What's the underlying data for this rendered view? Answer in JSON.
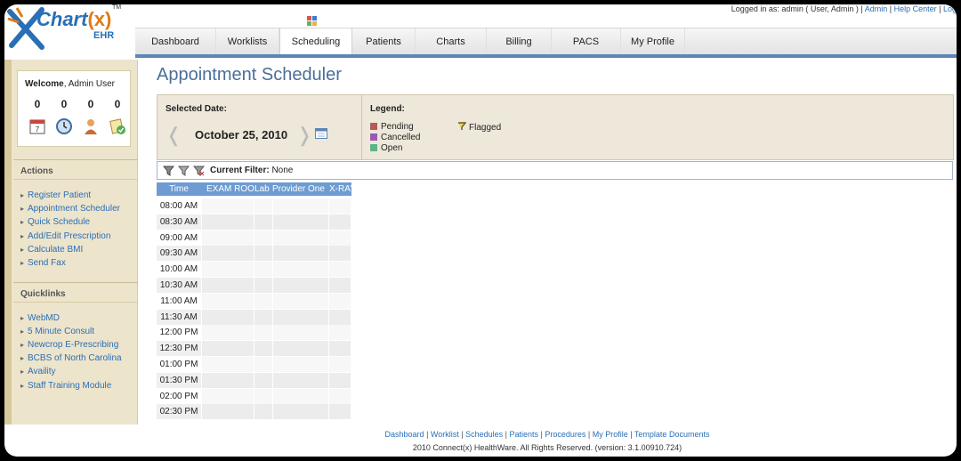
{
  "header": {
    "logo_text": "Chart",
    "logo_x": "(x)",
    "logo_sub": "EHR",
    "logo_tm": "TM",
    "logged_in": "Logged in as: admin ( User, Admin )  |",
    "help_link": "Admin",
    "help_center": "Help Center",
    "logout": "Log"
  },
  "tabs": [
    {
      "label": "Dashboard"
    },
    {
      "label": "Worklists"
    },
    {
      "label": "Scheduling"
    },
    {
      "label": "Patients"
    },
    {
      "label": "Charts"
    },
    {
      "label": "Billing"
    },
    {
      "label": "PACS"
    },
    {
      "label": "My Profile"
    }
  ],
  "sidebar": {
    "welcome_bold": "Welcome",
    "welcome_name": ", Admin User",
    "counts": [
      "0",
      "0",
      "0",
      "0"
    ],
    "actions_title": "Actions",
    "actions": [
      "Register Patient",
      "Appointment Scheduler",
      "Quick Schedule",
      "Add/Edit Prescription",
      "Calculate BMI",
      "Send Fax"
    ],
    "quicklinks_title": "Quicklinks",
    "quicklinks": [
      "WebMD",
      "5 Minute Consult",
      "Newcrop E-Prescribing",
      "BCBS of North Carolina",
      "Availity",
      "Staff Training Module"
    ]
  },
  "main": {
    "page_title": "Appointment Scheduler",
    "selected_date_label": "Selected Date:",
    "selected_date": "October 25, 2010",
    "legend_label": "Legend:",
    "legend": [
      {
        "label": "Pending",
        "color": "#b35a5a"
      },
      {
        "label": "Cancelled",
        "color": "#9b5bb5"
      },
      {
        "label": "Open",
        "color": "#5bb585"
      }
    ],
    "flagged_label": "Flagged",
    "filter_label": "Current Filter:",
    "filter_value": "None",
    "grid_headers": [
      "Time",
      "EXAM ROOM",
      "Lab",
      "Provider One",
      "X-RAY"
    ],
    "times": [
      "08:00 AM",
      "08:30 AM",
      "09:00 AM",
      "09:30 AM",
      "10:00 AM",
      "10:30 AM",
      "11:00 AM",
      "11:30 AM",
      "12:00 PM",
      "12:30 PM",
      "01:00 PM",
      "01:30 PM",
      "02:00 PM",
      "02:30 PM"
    ]
  },
  "footer": {
    "links": [
      "Dashboard",
      "Worklist",
      "Schedules",
      "Patients",
      "Procedures",
      "My Profile",
      "Template Documents"
    ],
    "copyright": "2010 Connect(x) HealthWare. All Rights Reserved. (version: 3.1.00910.724)"
  },
  "colors": {
    "accent": "#5b86b7",
    "grid_header": "#6e9bd2",
    "sidebar_bg": "#ede4cc"
  }
}
